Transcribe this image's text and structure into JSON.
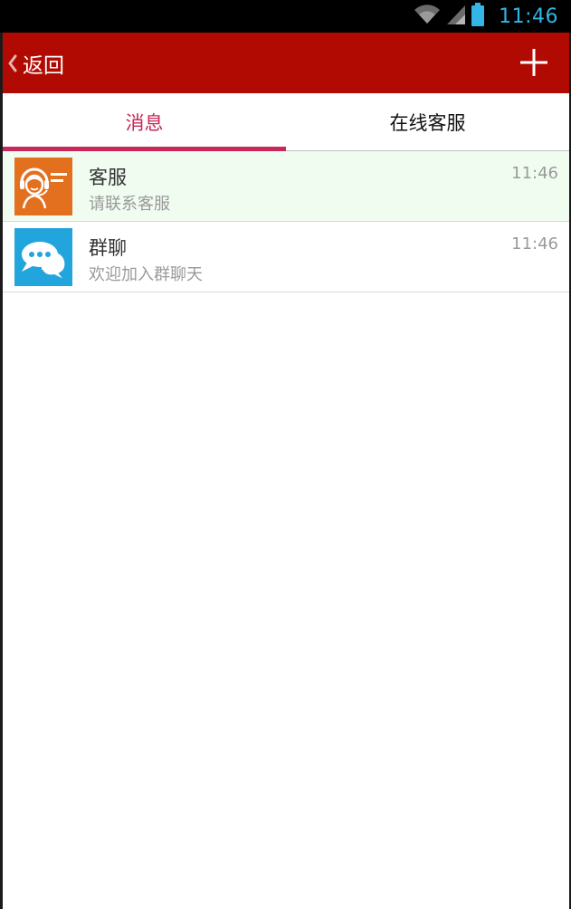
{
  "status_bar": {
    "time": "11:46",
    "icons": [
      "wifi-icon",
      "cell-signal-icon",
      "battery-icon"
    ],
    "time_color": "#33b5e5"
  },
  "header": {
    "back_label": "返回",
    "back_icon": "chevron-left-icon",
    "add_icon": "plus-icon",
    "background_color": "#b10a02"
  },
  "tabs": [
    {
      "label": "消息",
      "active": true
    },
    {
      "label": "在线客服",
      "active": false
    }
  ],
  "accent_color": "#c8285a",
  "conversations": [
    {
      "name": "客服",
      "preview": "请联系客服",
      "time": "11:46",
      "icon": "customer-service-icon",
      "icon_color": "#e2701f",
      "highlighted": true
    },
    {
      "name": "群聊",
      "preview": "欢迎加入群聊天",
      "time": "11:46",
      "icon": "chat-bubbles-icon",
      "icon_color": "#22a4dc",
      "highlighted": false
    }
  ]
}
